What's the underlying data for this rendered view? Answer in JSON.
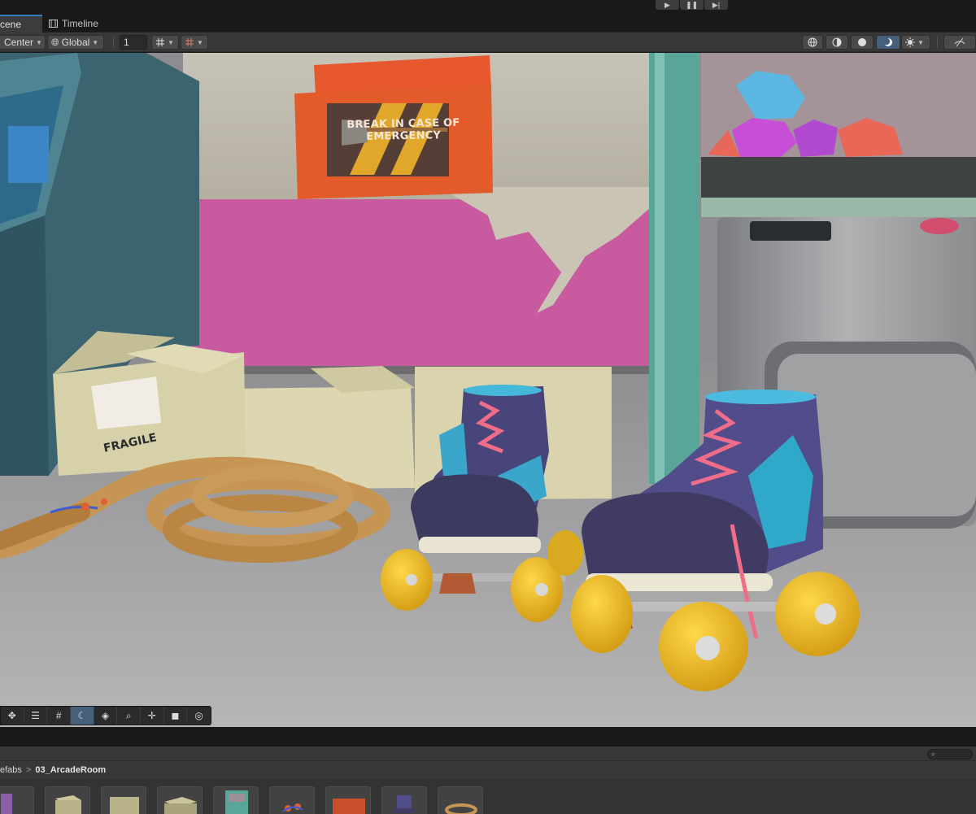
{
  "playmode": {
    "buttons": [
      {
        "name": "play-button",
        "icon": "play-icon",
        "glyph": "▶"
      },
      {
        "name": "pause-button",
        "icon": "pause-icon",
        "glyph": "❚❚"
      },
      {
        "name": "step-button",
        "icon": "step-icon",
        "glyph": "▶|"
      }
    ]
  },
  "tabs": {
    "scene_label": "cene",
    "timeline_label": "Timeline"
  },
  "toolbar": {
    "pivot_label": "Center",
    "space_label": "Global",
    "grid_value": "1"
  },
  "scene": {
    "sign_text": "BREAK IN CASE OF EMERGENCY",
    "box_label": "FRAGILE"
  },
  "view_tools": [
    "move-icon",
    "layers-icon",
    "grid-icon",
    "moon-icon",
    "stack-icon",
    "zoom-icon",
    "pan-icon",
    "camera-icon",
    "compass-icon"
  ],
  "project": {
    "breadcrumb_parent": "efabs",
    "breadcrumb_separator": ">",
    "breadcrumb_current": "03_ArcadeRoom",
    "search_placeholder": ""
  },
  "colors": {
    "accent": "#3a79bb",
    "selected": "#46607c",
    "panel": "#383838",
    "background": "#191919"
  }
}
